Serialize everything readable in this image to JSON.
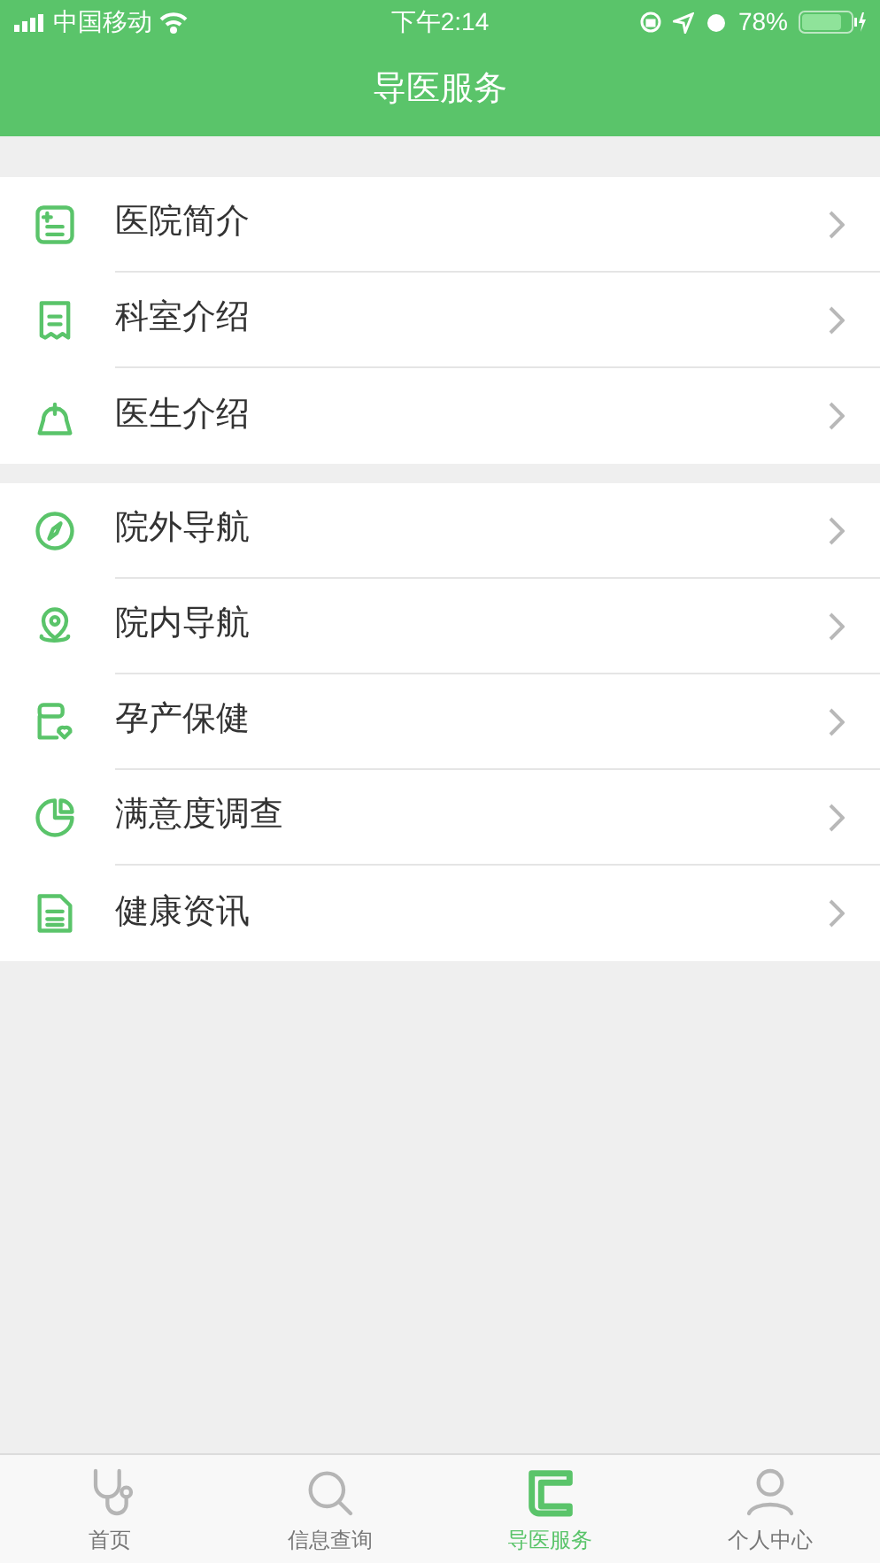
{
  "status_bar": {
    "carrier": "中国移动",
    "time": "下午2:14",
    "battery": "78%"
  },
  "header": {
    "title": "导医服务"
  },
  "groups": [
    {
      "items": [
        {
          "label": "医院简介"
        },
        {
          "label": "科室介绍"
        },
        {
          "label": "医生介绍"
        }
      ]
    },
    {
      "items": [
        {
          "label": "院外导航"
        },
        {
          "label": "院内导航"
        },
        {
          "label": "孕产保健"
        },
        {
          "label": "满意度调查"
        },
        {
          "label": "健康资讯"
        }
      ]
    }
  ],
  "tab_bar": [
    {
      "label": "首页",
      "selected": false
    },
    {
      "label": "信息查询",
      "selected": false
    },
    {
      "label": "导医服务",
      "selected": true
    },
    {
      "label": "个人中心",
      "selected": false
    }
  ]
}
